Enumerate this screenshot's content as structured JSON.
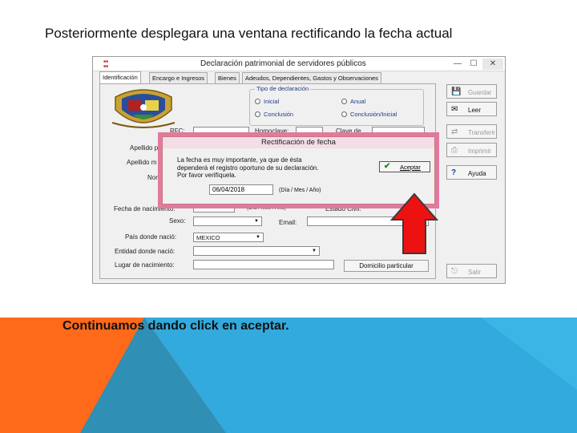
{
  "slide": {
    "title": "Posteriormente desplegara una ventana rectificando la fecha actual",
    "caption": "Continuamos dando click en aceptar."
  },
  "window": {
    "title": "Declaración patrimonial de servidores públicos",
    "controls": {
      "minimize": "—",
      "maximize": "☐",
      "close": "✕"
    },
    "tabs": [
      {
        "label": "Identificación",
        "active": true
      },
      {
        "label": "Encargo e Ingresos"
      },
      {
        "label": "Bienes"
      },
      {
        "label": "Adeudos, Dependientes, Gastos y Observaciones"
      }
    ],
    "tipo_declaracion": {
      "legend": "Tipo de declaración",
      "options": [
        "Inicial",
        "Anual",
        "Conclusión",
        "Conclusión/Inicial"
      ]
    },
    "labels": {
      "rfc": "RFC:",
      "homoclave": "Homoclave:",
      "clave": "Clave de",
      "apellido_paterno": "Apellido p",
      "apellido_materno": "Apellido m",
      "nombre": "Nom",
      "fecha_nacimiento": "Fecha de nacimiento:",
      "fecha_hint": "(Día / Mes / Año)",
      "estado_civil": "Estado Civil:",
      "sexo": "Sexo:",
      "email": "Email:",
      "pais": "País donde nació:",
      "entidad": "Entidad donde nació:",
      "lugar": "Lugar de nacimiento:"
    },
    "values": {
      "pais": "MEXICO"
    },
    "buttons": {
      "guardar": "Guardar",
      "leer": "Leer",
      "transferir": "Transferir",
      "imprimir": "Imprimir",
      "ayuda": "Ayuda",
      "salir": "Salir",
      "domicilio": "Domicilio particular"
    }
  },
  "dialog": {
    "title": "Rectificación de fecha",
    "message_lines": [
      "La fecha es muy importante, ya que de ésta",
      "dependerá el registro oportuno de su declaración.",
      "Por favor verifíquela."
    ],
    "date_value": "06/04/2018",
    "date_hint": "(Día / Mes / Año)",
    "accept_label": "Aceptar"
  },
  "colors": {
    "dialog_highlight": "#e07aa0",
    "arrow": "#ee1111",
    "band_blue": "#33aadd",
    "band_orange": "#ff6a1a",
    "band_teal": "#2f8fb5"
  }
}
